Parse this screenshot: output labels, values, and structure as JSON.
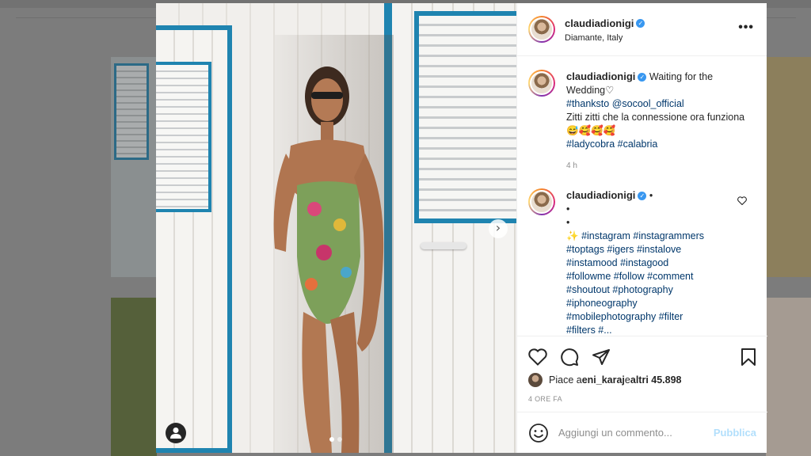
{
  "post": {
    "username": "claudiadionigi",
    "location": "Diamante, Italy",
    "more_label": "•••",
    "caption": {
      "text_start": "Waiting for the Wedding",
      "heart": "♡",
      "mention_line_tag": "#thanksto",
      "mention": "@socool_official",
      "text2": "Zitti zitti che la connessione ora funziona",
      "emojis2": "😅🥰🥰🥰",
      "tag1": "#ladycobra",
      "tag2": "#calabria"
    },
    "caption_time": "4 h",
    "comment2": {
      "after_name": " •",
      "dot1": "•",
      "dot2": "•",
      "sparkle": "✨",
      "hashtag_lines": [
        "#instagram #instagrammers",
        "#toptags #igers #instalove",
        "#instamood #instagood",
        "#followme #follow #comment",
        "#shoutout #photography",
        "#iphoneography",
        "#mobilephotography #filter",
        "#filters #..."
      ]
    },
    "likes": {
      "prefix": "Piace a ",
      "user": "eni_karaj",
      "middle": " e ",
      "count": "altri 45.898"
    },
    "time_ago": "4 ORE FA",
    "comment_placeholder": "Aggiungi un commento...",
    "publish_label": "Pubblica",
    "next_glyph": "›",
    "carousel": {
      "count": 2,
      "active": 0
    }
  },
  "colors": {
    "link": "#00376b",
    "verified": "#3897f0",
    "publish_disabled": "#b2dffc",
    "door_blue": "#1f84b0"
  },
  "icons": [
    "more-icon",
    "verified-icon",
    "heart-icon",
    "comment-icon",
    "share-icon",
    "save-icon",
    "emoji-icon",
    "tag-user-icon",
    "chevron-right-icon"
  ]
}
